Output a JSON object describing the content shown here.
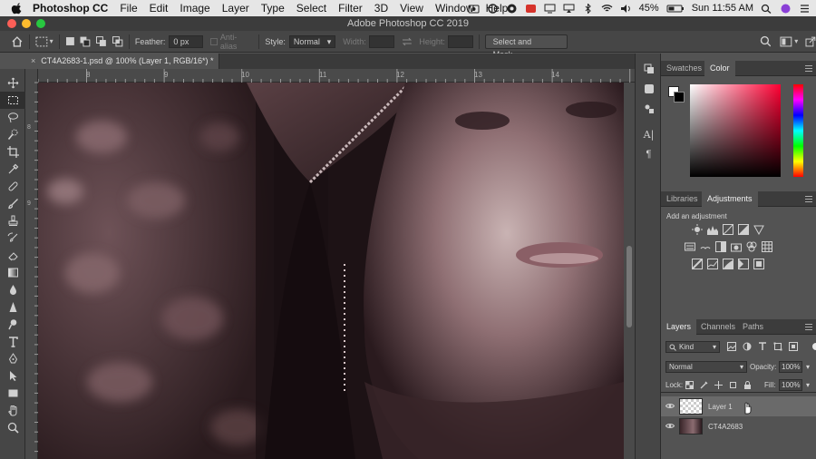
{
  "menubar": {
    "app_name": "Photoshop CC",
    "items": [
      "File",
      "Edit",
      "Image",
      "Layer",
      "Type",
      "Select",
      "Filter",
      "3D",
      "View",
      "Window",
      "Help"
    ],
    "battery": "45%",
    "clock": "Sun 11:55 AM"
  },
  "window": {
    "title": "Adobe Photoshop CC 2019"
  },
  "options": {
    "feather_label": "Feather:",
    "feather_value": "0 px",
    "antialias_label": "Anti-alias",
    "style_label": "Style:",
    "style_value": "Normal",
    "width_label": "Width:",
    "height_label": "Height:",
    "select_mask_label": "Select and Mask..."
  },
  "document": {
    "tab_title": "CT4A2683-1.psd @ 100% (Layer 1, RGB/16*) *",
    "ruler_h_ticks": [
      "8",
      "9",
      "10",
      "11",
      "12",
      "13",
      "14"
    ],
    "ruler_v_ticks": [
      "8",
      "9",
      "1\n0",
      "1\n1",
      "1\n2"
    ]
  },
  "color_panel": {
    "tabs": [
      "Swatches",
      "Color"
    ],
    "active_tab": "Color"
  },
  "adjustments_panel": {
    "tabs": [
      "Libraries",
      "Adjustments"
    ],
    "active_tab": "Adjustments",
    "hint": "Add an adjustment"
  },
  "layers_panel": {
    "tabs": [
      "Layers",
      "Channels",
      "Paths"
    ],
    "active_tab": "Layers",
    "filter_kind": "Kind",
    "blend_mode": "Normal",
    "opacity_label": "Opacity:",
    "opacity_value": "100%",
    "lock_label": "Lock:",
    "fill_label": "Fill:",
    "fill_value": "100%",
    "layers": [
      {
        "name": "Layer 1",
        "selected": true
      },
      {
        "name": "CT4A2683",
        "selected": false
      }
    ]
  },
  "colors": {
    "menubar_bg": "#e6e6e6",
    "panel_bg": "#535353",
    "panel_dark": "#3c3c3c",
    "close_red": "#fc5f57",
    "min_yellow": "#fdbc2e",
    "max_green": "#28c840"
  }
}
